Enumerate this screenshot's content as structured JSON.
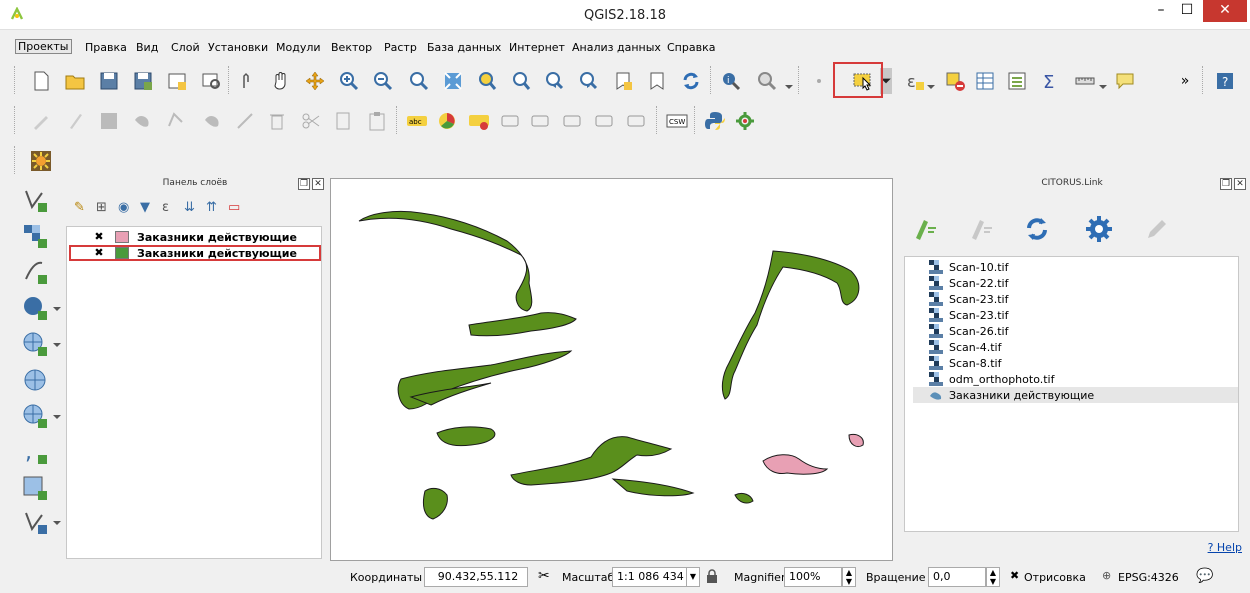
{
  "window": {
    "title": "QGIS2.18.18",
    "min_glyph": "–",
    "max_glyph": "☐",
    "close_glyph": "✕"
  },
  "menu": [
    {
      "label": "Проекты",
      "active": true
    },
    {
      "label": "Правка"
    },
    {
      "label": "Вид"
    },
    {
      "label": "Слой"
    },
    {
      "label": "Установки"
    },
    {
      "label": "Модули"
    },
    {
      "label": "Вектор"
    },
    {
      "label": "Растр"
    },
    {
      "label": "База данных"
    },
    {
      "label": "Интернет"
    },
    {
      "label": "Анализ данных"
    },
    {
      "label": "Справка"
    }
  ],
  "toolbar_overflow": "»",
  "label_tools": {
    "abc": "abc",
    "csw": "CSW"
  },
  "layers_panel": {
    "title": "Панель слоёв",
    "float_glyph": "❐",
    "close_glyph": "✕",
    "layers": [
      {
        "name": "Заказники действующие",
        "checked": true,
        "color": "#e8a0b4",
        "selected": false
      },
      {
        "name": "Заказники действующие",
        "checked": true,
        "color": "#4a9a3c",
        "selected": true
      }
    ],
    "check_glyph": "✖"
  },
  "citorus_panel": {
    "title": "CITORUS.Link",
    "items": [
      {
        "name": "Scan-10.tif",
        "type": "raster"
      },
      {
        "name": "Scan-22.tif",
        "type": "raster"
      },
      {
        "name": "Scan-23.tif",
        "type": "raster"
      },
      {
        "name": "Scan-23.tif",
        "type": "raster"
      },
      {
        "name": "Scan-26.tif",
        "type": "raster"
      },
      {
        "name": "Scan-4.tif",
        "type": "raster"
      },
      {
        "name": "Scan-8.tif",
        "type": "raster"
      },
      {
        "name": "odm_orthophoto.tif",
        "type": "raster"
      },
      {
        "name": "Заказники действующие",
        "type": "vector",
        "selected": true
      }
    ],
    "help": "? Help"
  },
  "map": {
    "fill_main": "#5a8f1c",
    "fill_pink": "#e8a0b4",
    "stroke": "#1a1a1a"
  },
  "status": {
    "coords_label": "Координаты",
    "coords_value": "90.432,55.112",
    "scale_label": "Масштаб",
    "scale_value": "1:1 086 434",
    "magnifier_label": "Magnifier",
    "magnifier_value": "100%",
    "rotation_label": "Вращение",
    "rotation_value": "0,0",
    "render_label": "Отрисовка",
    "crs": "EPSG:4326"
  }
}
